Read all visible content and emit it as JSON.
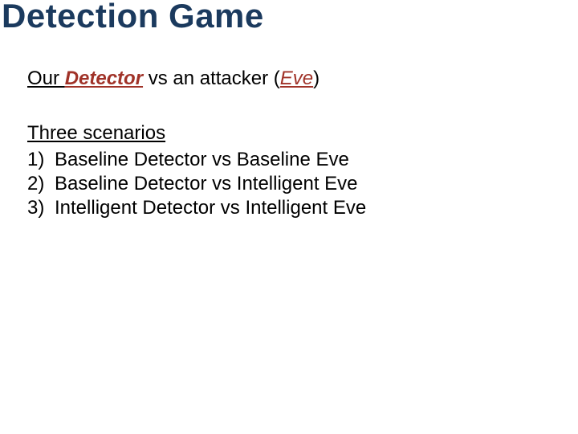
{
  "title": "Detection Game",
  "sub": {
    "our": "Our ",
    "detector": "Detector",
    "mid": " vs an attacker (",
    "eve": "Eve",
    "close": ")"
  },
  "scen_head": "Three scenarios",
  "items": [
    {
      "n": "1)",
      "t": "Baseline Detector vs Baseline Eve"
    },
    {
      "n": "2)",
      "t": "Baseline Detector vs Intelligent Eve"
    },
    {
      "n": "3)",
      "t": "Intelligent Detector vs Intelligent Eve"
    }
  ]
}
